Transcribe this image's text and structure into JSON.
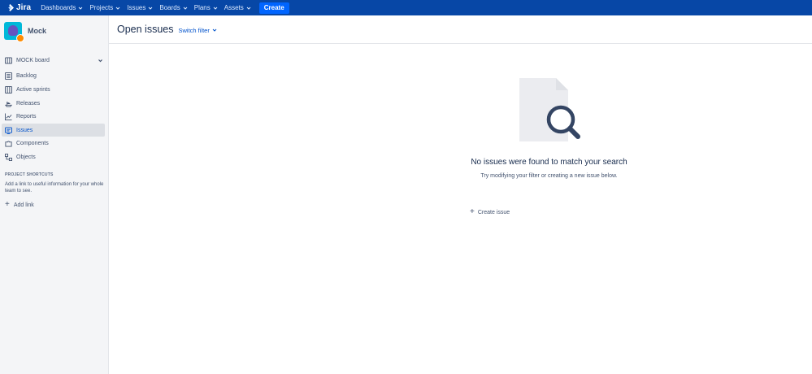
{
  "topnav": {
    "brand": "Jira",
    "items": [
      {
        "label": "Dashboards"
      },
      {
        "label": "Projects"
      },
      {
        "label": "Issues"
      },
      {
        "label": "Boards"
      },
      {
        "label": "Plans"
      },
      {
        "label": "Assets"
      }
    ],
    "create_label": "Create"
  },
  "sidebar": {
    "project_name": "Mock",
    "board_label": "MOCK board",
    "items": [
      {
        "label": "Backlog",
        "icon": "backlog-icon"
      },
      {
        "label": "Active sprints",
        "icon": "board-icon"
      },
      {
        "label": "Releases",
        "icon": "ship-icon"
      },
      {
        "label": "Reports",
        "icon": "chart-icon"
      },
      {
        "label": "Issues",
        "icon": "issues-icon",
        "active": true
      },
      {
        "label": "Components",
        "icon": "puzzle-icon"
      },
      {
        "label": "Objects",
        "icon": "objects-icon"
      }
    ],
    "shortcuts_title": "PROJECT SHORTCUTS",
    "shortcuts_desc": "Add a link to useful information for your whole team to see.",
    "add_link_label": "Add link"
  },
  "main": {
    "title": "Open issues",
    "switch_filter_label": "Switch filter",
    "empty_title": "No issues were found to match your search",
    "empty_subtitle": "Try modifying your filter or creating a new issue below.",
    "create_issue_label": "Create issue"
  },
  "colors": {
    "topbar": "#0747a6",
    "create_button": "#0065ff",
    "link": "#0052cc",
    "sidebar_bg": "#f4f5f7",
    "active_item_bg": "#dcdfe4"
  }
}
